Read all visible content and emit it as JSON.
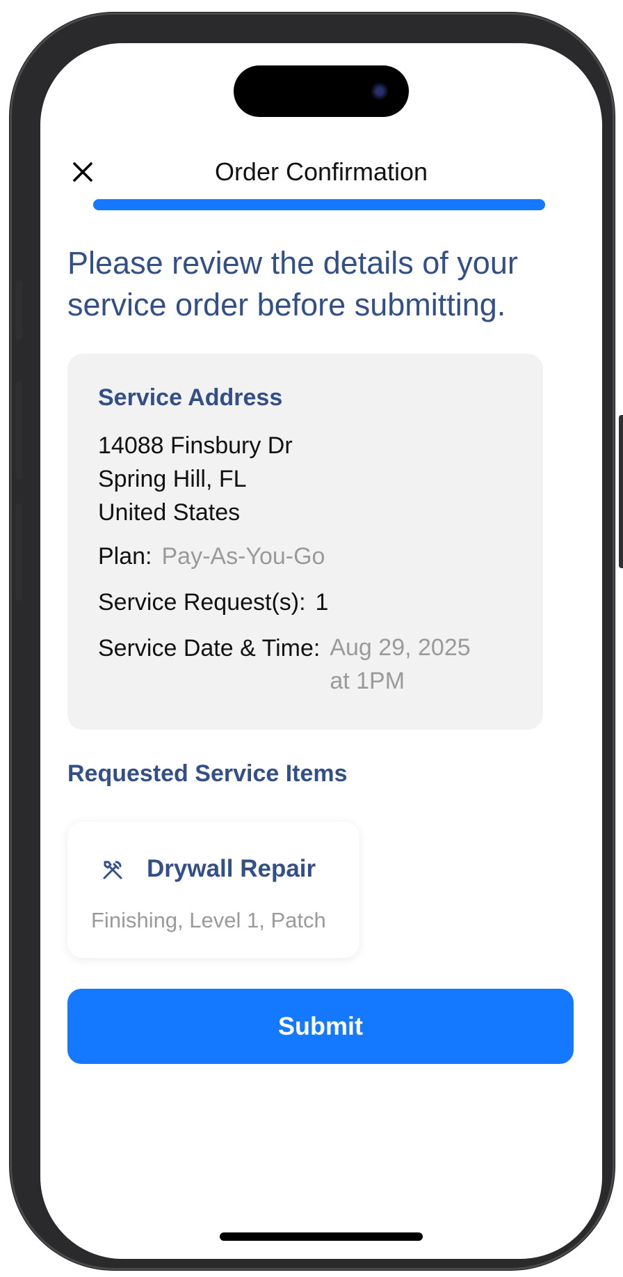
{
  "header": {
    "title": "Order Confirmation",
    "progress_fraction": 1.0
  },
  "intro": {
    "text": "Please review the details of your service order before submitting."
  },
  "summary": {
    "heading": "Service Address",
    "address_line1": "14088 Finsbury Dr",
    "address_line2": "Spring Hill, FL",
    "address_line3": "United States",
    "plan_label": "Plan:",
    "plan_value": "Pay-As-You-Go",
    "requests_label": "Service Request(s):",
    "requests_value": "1",
    "datetime_label": "Service Date & Time:",
    "datetime_value_line1": "Aug 29, 2025",
    "datetime_value_line2": "at 1PM"
  },
  "items_section": {
    "title": "Requested Service Items",
    "items": [
      {
        "icon": "tools-icon",
        "name": "Drywall Repair",
        "details": "Finishing, Level 1, Patch"
      }
    ]
  },
  "actions": {
    "submit_label": "Submit"
  },
  "colors": {
    "accent": "#1479ff",
    "heading": "#324f87",
    "muted": "#9a9a9a",
    "card_bg": "#f2f2f2"
  }
}
